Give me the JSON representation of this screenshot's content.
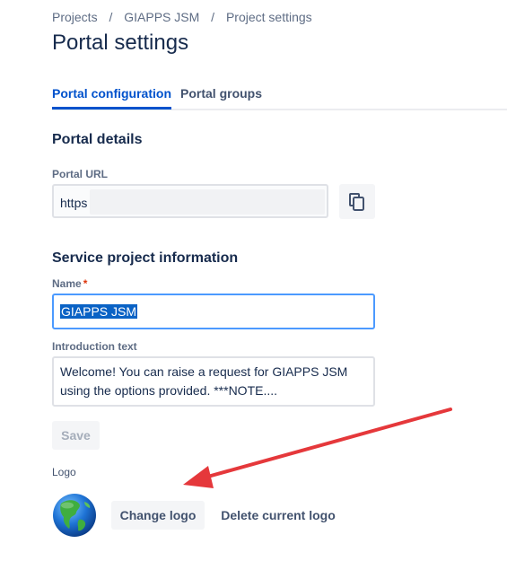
{
  "breadcrumb": {
    "items": [
      "Projects",
      "GIAPPS JSM",
      "Project settings"
    ],
    "separator": "/"
  },
  "page": {
    "title": "Portal settings"
  },
  "tabs": [
    {
      "label": "Portal configuration",
      "active": true
    },
    {
      "label": "Portal groups",
      "active": false
    }
  ],
  "portal_details": {
    "heading": "Portal details",
    "url_label": "Portal URL",
    "url_value": "https"
  },
  "service_info": {
    "heading": "Service project information",
    "name_label": "Name",
    "required_marker": "*",
    "name_value": "GIAPPS JSM",
    "intro_label": "Introduction text",
    "intro_value": "Welcome! You can raise a request for GIAPPS JSM using the options provided.  ***NOTE...."
  },
  "actions": {
    "save_label": "Save"
  },
  "logo": {
    "label": "Logo",
    "change_label": "Change logo",
    "delete_label": "Delete current logo",
    "image_icon": "globe-icon"
  },
  "annotation": {
    "arrow_color": "#e5383b"
  },
  "colors": {
    "accent": "#0052cc",
    "focus_border": "#4c9aff",
    "text": "#172b4d",
    "subtle_text": "#5e6c84"
  }
}
